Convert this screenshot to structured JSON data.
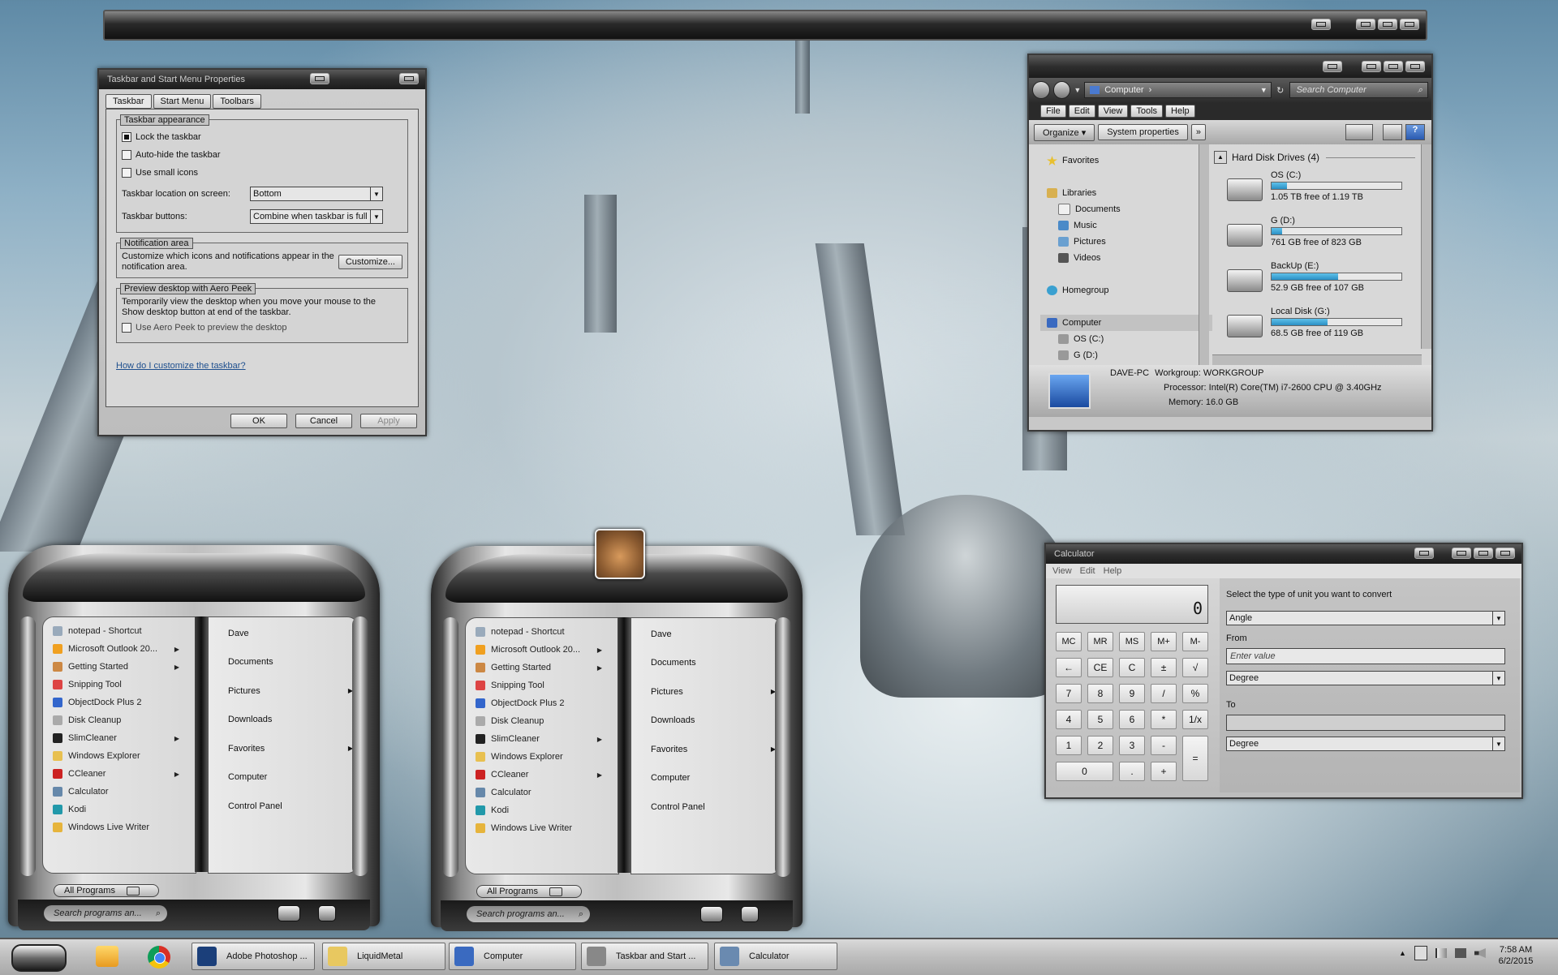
{
  "taskbar_props": {
    "title": "Taskbar and Start Menu Properties",
    "tabs": [
      "Taskbar",
      "Start Menu",
      "Toolbars"
    ],
    "appearance_label": "Taskbar appearance",
    "lock_label": "Lock the taskbar",
    "lock_checked": true,
    "autohide_label": "Auto-hide the taskbar",
    "autohide_checked": false,
    "small_icons_label": "Use small icons",
    "small_icons_checked": false,
    "location_label": "Taskbar location on screen:",
    "location_value": "Bottom",
    "buttons_label": "Taskbar buttons:",
    "buttons_value": "Combine when taskbar is full",
    "notif_label": "Notification area",
    "notif_text": "Customize which icons and notifications appear in the notification area.",
    "customize_btn": "Customize...",
    "peek_label": "Preview desktop with Aero Peek",
    "peek_text": "Temporarily view the desktop when you move your mouse to the Show desktop button at end of the taskbar.",
    "peek_check_label": "Use Aero Peek to preview the desktop",
    "peek_checked": false,
    "help_link": "How do I customize the taskbar?",
    "ok": "OK",
    "cancel": "Cancel",
    "apply": "Apply"
  },
  "explorer": {
    "address": "Computer",
    "search_placeholder": "Search Computer",
    "menu": [
      "File",
      "Edit",
      "View",
      "Tools",
      "Help"
    ],
    "organize": "Organize",
    "system_properties": "System properties",
    "more": "»",
    "nav": {
      "favorites": "Favorites",
      "libraries": "Libraries",
      "documents": "Documents",
      "music": "Music",
      "pictures": "Pictures",
      "videos": "Videos",
      "homegroup": "Homegroup",
      "computer": "Computer",
      "os": "OS (C:)",
      "g": "G (D:)"
    },
    "section_title": "Hard Disk Drives (4)",
    "drives": [
      {
        "name": "OS (C:)",
        "free": "1.05 TB free of 1.19 TB",
        "used": 0.12
      },
      {
        "name": "G (D:)",
        "free": "761 GB free of 823 GB",
        "used": 0.08
      },
      {
        "name": "BackUp (E:)",
        "free": "52.9 GB free of 107 GB",
        "used": 0.51
      },
      {
        "name": "Local Disk (G:)",
        "free": "68.5 GB free of 119 GB",
        "used": 0.43
      }
    ],
    "details": {
      "pc_name": "DAVE-PC",
      "workgroup_label": "Workgroup:",
      "workgroup": "WORKGROUP",
      "processor_label": "Processor:",
      "processor": "Intel(R) Core(TM) i7-2600 CPU @ 3.40GHz",
      "memory_label": "Memory:",
      "memory": "16.0 GB"
    }
  },
  "start_menu": {
    "programs": [
      {
        "label": "notepad - Shortcut",
        "icon": "notepad-icon",
        "sub": false,
        "color": "#9ab"
      },
      {
        "label": "Microsoft Outlook 20...",
        "icon": "outlook-icon",
        "sub": true,
        "color": "#f0a020"
      },
      {
        "label": "Getting Started",
        "icon": "getting-started-icon",
        "sub": true,
        "color": "#c84"
      },
      {
        "label": "Snipping Tool",
        "icon": "snipping-tool-icon",
        "sub": false,
        "color": "#d44"
      },
      {
        "label": "ObjectDock Plus 2",
        "icon": "objectdock-icon",
        "sub": false,
        "color": "#36c"
      },
      {
        "label": "Disk Cleanup",
        "icon": "disk-cleanup-icon",
        "sub": false,
        "color": "#aaa"
      },
      {
        "label": "SlimCleaner",
        "icon": "slimcleaner-icon",
        "sub": true,
        "color": "#222"
      },
      {
        "label": "Windows Explorer",
        "icon": "explorer-icon",
        "sub": false,
        "color": "#e8c050"
      },
      {
        "label": "CCleaner",
        "icon": "ccleaner-icon",
        "sub": true,
        "color": "#c22"
      },
      {
        "label": "Calculator",
        "icon": "calculator-icon",
        "sub": false,
        "color": "#68a"
      },
      {
        "label": "Kodi",
        "icon": "kodi-icon",
        "sub": false,
        "color": "#29a"
      },
      {
        "label": "Windows Live Writer",
        "icon": "live-writer-icon",
        "sub": false,
        "color": "#e6b43c"
      }
    ],
    "places": [
      {
        "label": "Dave",
        "sub": false
      },
      {
        "label": "Documents",
        "sub": false
      },
      {
        "label": "Pictures",
        "sub": true
      },
      {
        "label": "Downloads",
        "sub": false
      },
      {
        "label": "Favorites",
        "sub": true
      },
      {
        "label": "Computer",
        "sub": false
      },
      {
        "label": "Control Panel",
        "sub": false
      }
    ],
    "all_programs": "All Programs",
    "search_placeholder": "Search programs an..."
  },
  "calculator": {
    "title": "Calculator",
    "menu": [
      "View",
      "Edit",
      "Help"
    ],
    "display": "0",
    "memory_keys": [
      "MC",
      "MR",
      "MS",
      "M+",
      "M-"
    ],
    "row2": [
      "←",
      "CE",
      "C",
      "±",
      "√"
    ],
    "row3": [
      "7",
      "8",
      "9",
      "/",
      "%"
    ],
    "row4": [
      "4",
      "5",
      "6",
      "*",
      "1/x"
    ],
    "row5": [
      "1",
      "2",
      "3",
      "-"
    ],
    "row6": [
      "0",
      ".",
      "+"
    ],
    "equals": "=",
    "convert_prompt": "Select the type of unit you want to convert",
    "unit_type": "Angle",
    "from_label": "From",
    "from_placeholder": "Enter value",
    "from_unit": "Degree",
    "to_label": "To",
    "to_unit": "Degree"
  },
  "taskbar": {
    "apps": [
      {
        "label": "Adobe Photoshop ...",
        "icon": "photoshop-icon",
        "color": "#1b3f7a"
      },
      {
        "label": "LiquidMetal",
        "icon": "folder-icon",
        "color": "#e8c860"
      },
      {
        "label": "Computer",
        "icon": "computer-icon",
        "color": "#3a6ac0"
      },
      {
        "label": "Taskbar and Start ...",
        "icon": "taskbar-props-icon",
        "color": "#888"
      },
      {
        "label": "Calculator",
        "icon": "calculator-icon",
        "color": "#6a8ab0"
      }
    ],
    "time": "7:58 AM",
    "date": "6/2/2015"
  }
}
